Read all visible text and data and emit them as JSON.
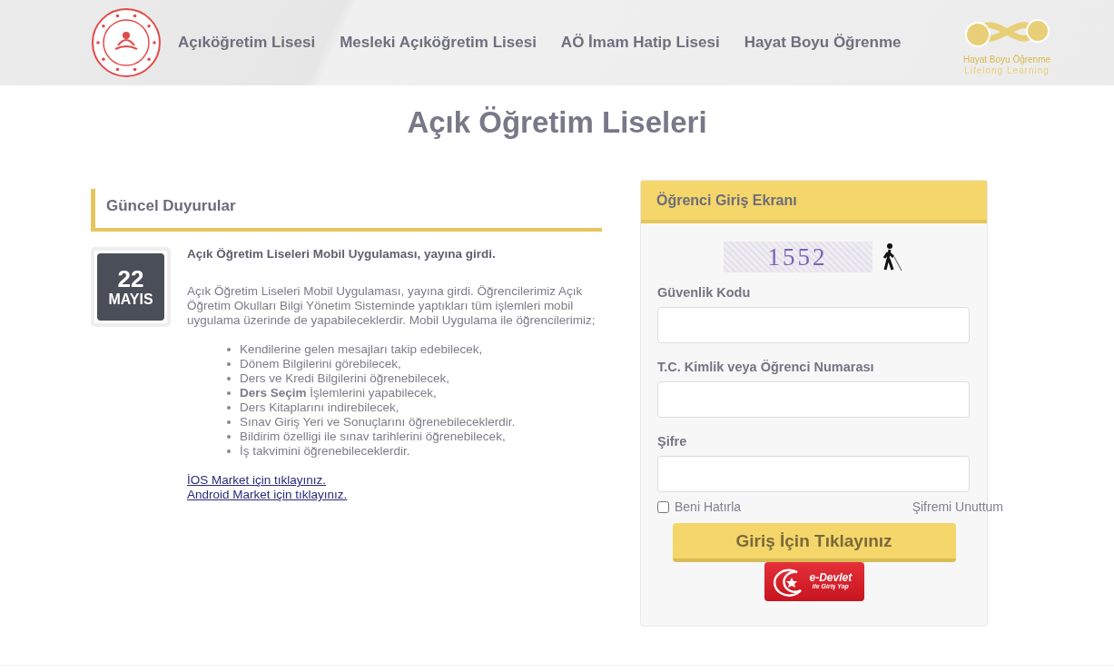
{
  "header": {
    "nav": [
      {
        "label": "Açıköğretim Lisesi"
      },
      {
        "label": "Mesleki Açıköğretim Lisesi"
      },
      {
        "label": "AÖ İmam Hatip Lisesi"
      },
      {
        "label": "Hayat Boyu Öğrenme"
      }
    ],
    "logo_right": {
      "line_1": "Hayat Boyu Öğrenme",
      "line_2": "Lifelong Learning"
    }
  },
  "page_title": "Açık Öğretim Liseleri",
  "announcements": {
    "title": "Güncel Duyurular",
    "items": [
      {
        "day": "22",
        "month": "MAYIS",
        "headline": "Açık Öğretim Liseleri Mobil Uygulaması, yayına girdi.",
        "body": "Açık Öğretim Liseleri Mobil Uygulaması, yayına girdi. Öğrencilerimiz Açık Öğretim Okulları Bilgi Yönetim Sisteminde yaptıkları tüm işlemleri mobil uygulama üzerinde de yapabileceklerdir. Mobil Uygulama ile öğrencilerimiz;",
        "bullets": [
          "Kendilerine gelen mesajları takip edebilecek,",
          "Dönem Bilgilerini görebilecek,",
          "Ders ve Kredi Bilgilerini öğrenebilecek,",
          "**Ders Seçim** İşlemlerini yapabilecek,",
          "Ders Kitaplarını indirebilecek,",
          "Sınav Giriş Yeri ve Sonuçlarını öğrenebileceklerdir.",
          "Bildirim özelligi ile sınav tarihlerini öğrenebilecek,",
          "İş takvimini öğrenebileceklerdir."
        ],
        "links": [
          "İOS Market için tıklayınız.",
          "Android Market için tıklayınız."
        ]
      }
    ]
  },
  "login": {
    "title": "Öğrenci Giriş Ekranı",
    "captcha": "1552",
    "fields": [
      {
        "label": "Güvenlik Kodu"
      },
      {
        "label": "T.C. Kimlik veya Öğrenci Numarası"
      },
      {
        "label": "Şifre"
      }
    ],
    "remember": {
      "label": "Beni Hatırla",
      "checked": false
    },
    "forgot": "Şifremi Unuttum",
    "submit": "Giriş İçin Tıklayınız",
    "edevlet": {
      "line_1": "e-Devlet",
      "line_2": "ile Giriş Yap"
    }
  }
}
